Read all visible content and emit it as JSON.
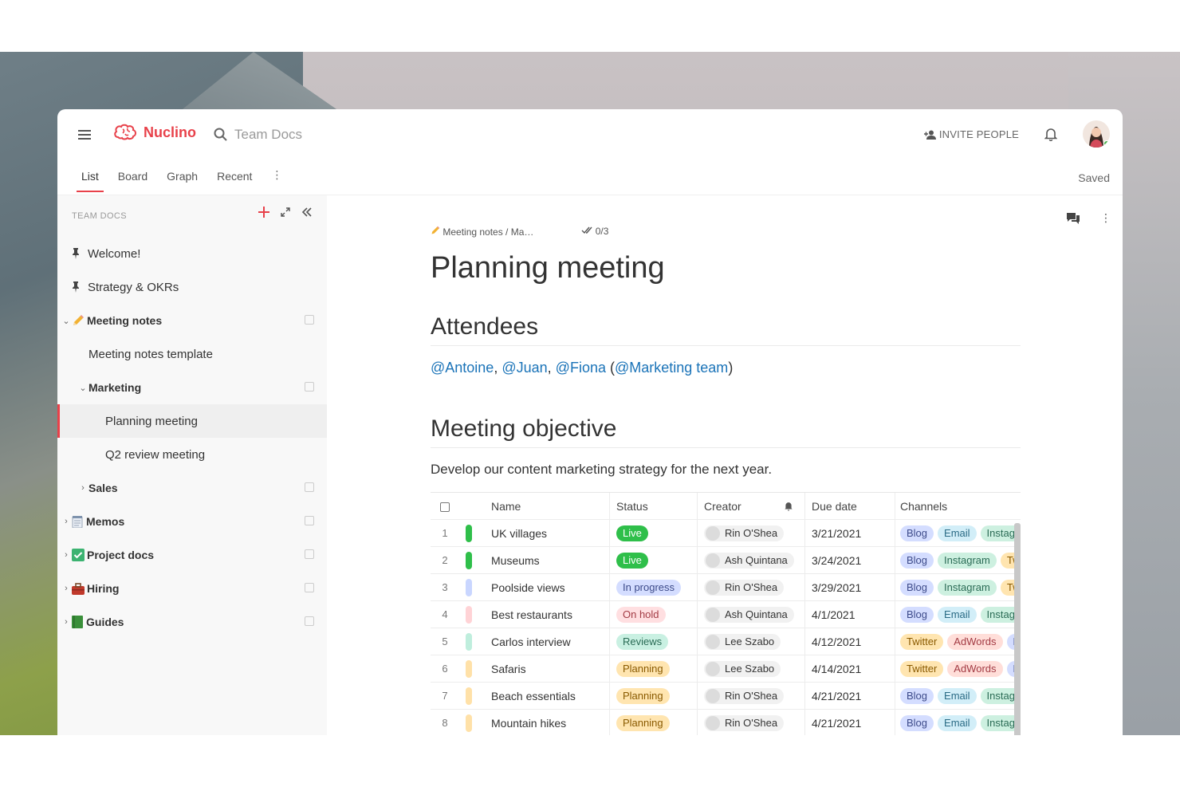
{
  "app": {
    "logo": "Nuclino",
    "search_placeholder": "Team Docs",
    "invite": "INVITE PEOPLE",
    "saved": "Saved"
  },
  "tabs": [
    {
      "label": "List"
    },
    {
      "label": "Board"
    },
    {
      "label": "Graph"
    },
    {
      "label": "Recent"
    }
  ],
  "sidebar": {
    "header": "TEAM DOCS",
    "items": [
      {
        "label": "Welcome!",
        "icon": "pin-icon",
        "level": 0
      },
      {
        "label": "Strategy & OKRs",
        "icon": "pin-icon",
        "level": 0
      },
      {
        "label": "Meeting notes",
        "icon": "pencil-icon",
        "level": 0,
        "expanded": true
      },
      {
        "label": "Meeting notes template",
        "level": 1
      },
      {
        "label": "Marketing",
        "level": 1,
        "expanded": true
      },
      {
        "label": "Planning meeting",
        "level": 2,
        "active": true
      },
      {
        "label": "Q2 review meeting",
        "level": 2
      },
      {
        "label": "Sales",
        "level": 1
      },
      {
        "label": "Memos",
        "icon": "notepad-icon",
        "level": 0
      },
      {
        "label": "Project docs",
        "icon": "checkbox-icon",
        "level": 0
      },
      {
        "label": "Hiring",
        "icon": "briefcase-icon",
        "level": 0
      },
      {
        "label": "Guides",
        "icon": "book-icon",
        "level": 0
      }
    ]
  },
  "doc": {
    "breadcrumb": "Meeting notes / Ma…",
    "tasks": "0/3",
    "title": "Planning meeting",
    "attendees_heading": "Attendees",
    "mentions": [
      "@Antoine",
      "@Juan",
      "@Fiona",
      "@Marketing team"
    ],
    "objective_heading": "Meeting objective",
    "objective_text": "Develop our content marketing strategy for the next year."
  },
  "table": {
    "columns": [
      "Name",
      "Status",
      "Creator",
      "Due date",
      "Channels"
    ],
    "rows": [
      {
        "n": "1",
        "color": "#2fbf4a",
        "name": "UK villages",
        "status": "Live",
        "creator": "Rin O'Shea",
        "due": "3/21/2021",
        "channels": [
          "Blog",
          "Email",
          "Instagr"
        ]
      },
      {
        "n": "2",
        "color": "#2fbf4a",
        "name": "Museums",
        "status": "Live",
        "creator": "Ash Quintana",
        "due": "3/24/2021",
        "channels": [
          "Blog",
          "Instagram",
          "Tw"
        ]
      },
      {
        "n": "3",
        "color": "#c9d6ff",
        "name": "Poolside views",
        "status": "In progress",
        "creator": "Rin O'Shea",
        "due": "3/29/2021",
        "channels": [
          "Blog",
          "Instagram",
          "Tw"
        ]
      },
      {
        "n": "4",
        "color": "#ffd3d6",
        "name": "Best restaurants",
        "status": "On hold",
        "creator": "Ash Quintana",
        "due": "4/1/2021",
        "channels": [
          "Blog",
          "Email",
          "Instagr"
        ]
      },
      {
        "n": "5",
        "color": "#bfeedd",
        "name": "Carlos interview",
        "status": "Reviews",
        "creator": "Lee Szabo",
        "due": "4/12/2021",
        "channels": [
          "Twitter",
          "AdWords",
          "B"
        ]
      },
      {
        "n": "6",
        "color": "#ffe1a8",
        "name": "Safaris",
        "status": "Planning",
        "creator": "Lee Szabo",
        "due": "4/14/2021",
        "channels": [
          "Twitter",
          "AdWords",
          "B"
        ]
      },
      {
        "n": "7",
        "color": "#ffe1a8",
        "name": "Beach essentials",
        "status": "Planning",
        "creator": "Rin O'Shea",
        "due": "4/21/2021",
        "channels": [
          "Blog",
          "Email",
          "Instagr"
        ]
      },
      {
        "n": "8",
        "color": "#ffe1a8",
        "name": "Mountain hikes",
        "status": "Planning",
        "creator": "Rin O'Shea",
        "due": "4/21/2021",
        "channels": [
          "Blog",
          "Email",
          "Instagr"
        ]
      }
    ]
  },
  "colors": {
    "accent": "#e8414a",
    "mention": "#1a73b8"
  }
}
